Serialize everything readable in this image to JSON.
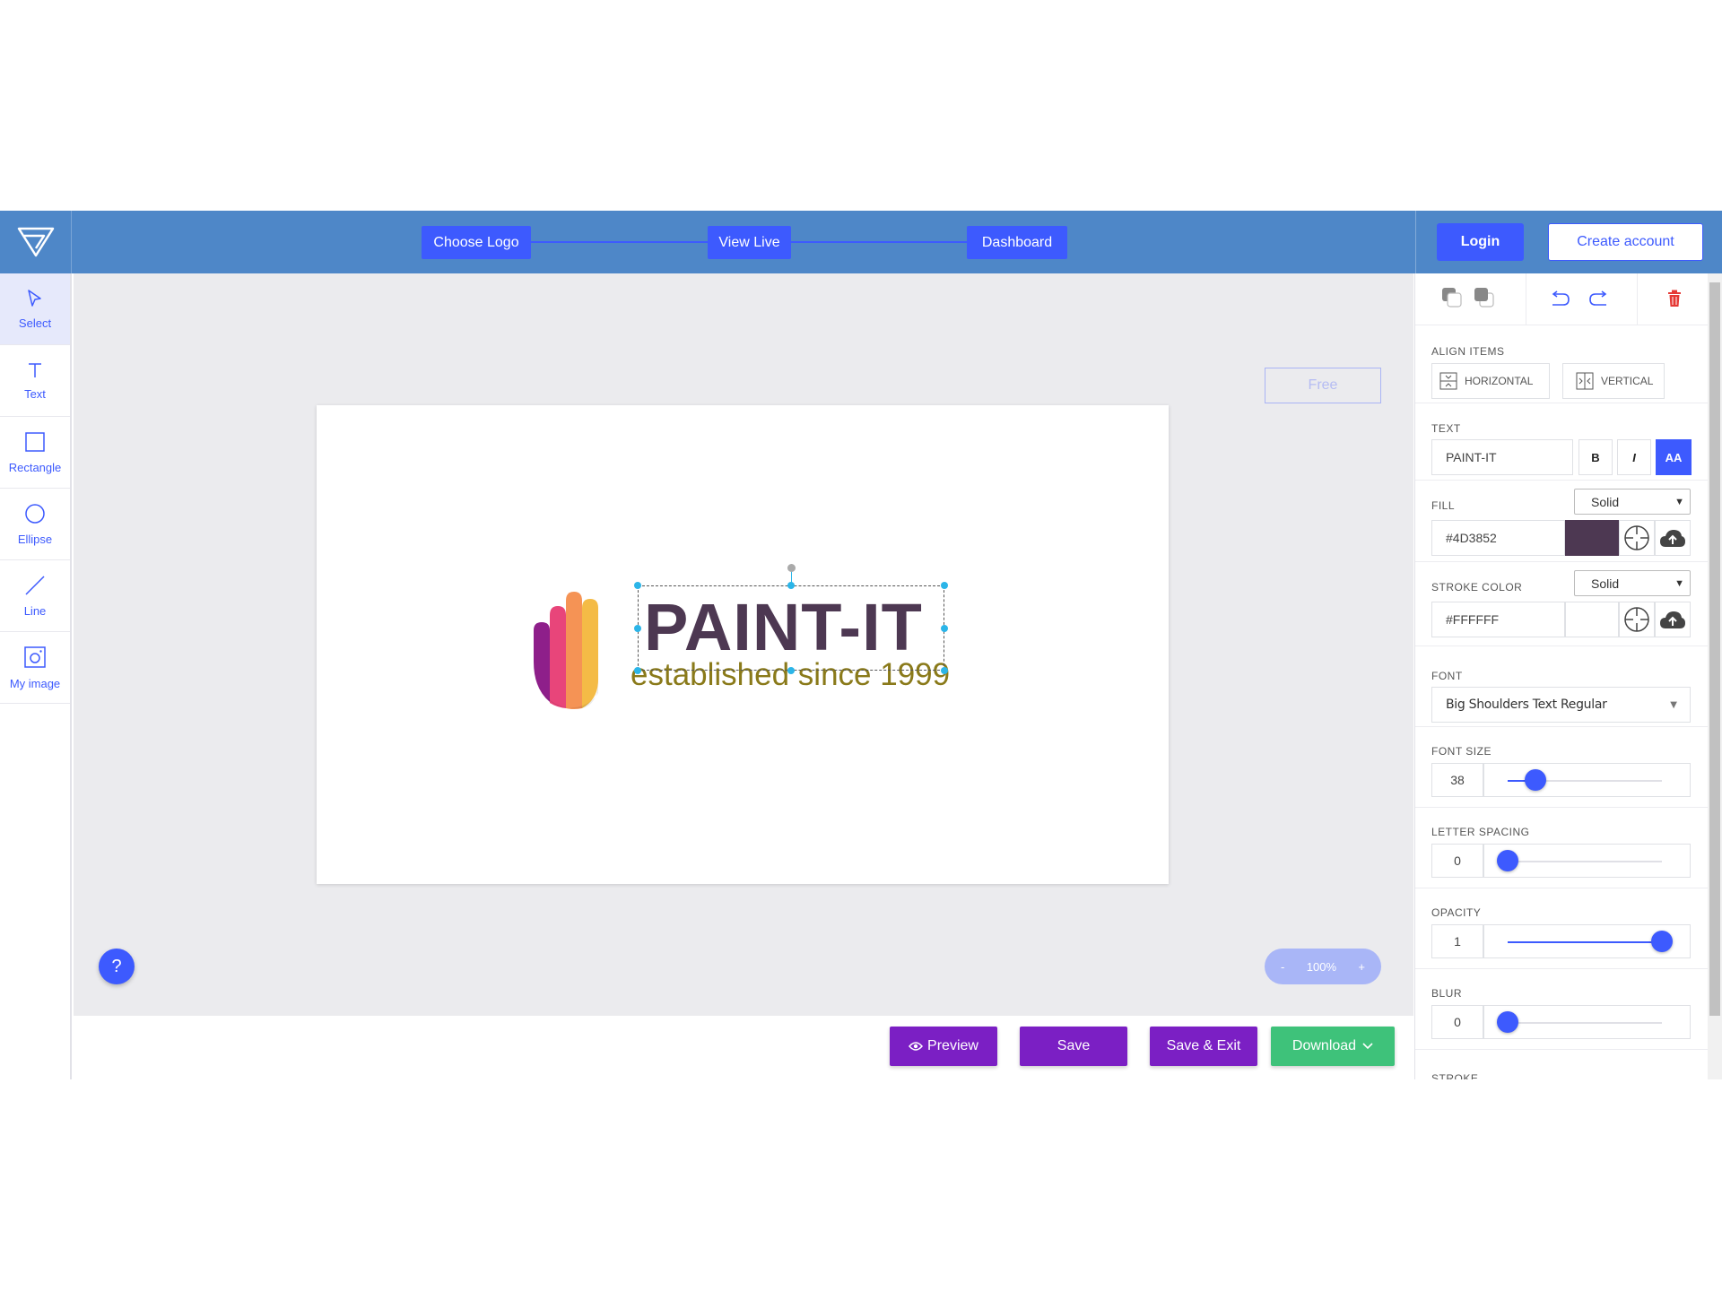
{
  "topbar": {
    "steps": [
      "Choose Logo",
      "View Live",
      "Dashboard"
    ],
    "login_label": "Login",
    "create_account_label": "Create account",
    "color": "#4e87c8",
    "accent": "#3d5afe"
  },
  "tools": [
    {
      "label": "Select",
      "icon": "cursor-icon"
    },
    {
      "label": "Text",
      "icon": "text-icon"
    },
    {
      "label": "Rectangle",
      "icon": "rectangle-icon"
    },
    {
      "label": "Ellipse",
      "icon": "ellipse-icon"
    },
    {
      "label": "Line",
      "icon": "line-icon"
    },
    {
      "label": "My image",
      "icon": "image-icon"
    }
  ],
  "canvas": {
    "free_label": "Free",
    "brand_text": "PAINT-IT",
    "tagline": "established since 1999",
    "help_label": "?",
    "zoom": {
      "minus": "-",
      "value": "100%",
      "plus": "+"
    }
  },
  "actions": {
    "preview_label": "Preview",
    "save_label": "Save",
    "save_exit_label": "Save & Exit",
    "download_label": "Download",
    "colors": {
      "purple": "#7b1fc4",
      "green": "#3ec27a"
    }
  },
  "panel": {
    "align_items": {
      "label": "ALIGN ITEMS",
      "horizontal": "HORIZONTAL",
      "vertical": "VERTICAL"
    },
    "text": {
      "label": "TEXT",
      "value": "PAINT-IT",
      "bold": "B",
      "italic": "I",
      "caps": "AA"
    },
    "fill": {
      "label": "FILL",
      "mode": "Solid",
      "value": "#4D3852",
      "swatch": "#4d3852"
    },
    "stroke_color": {
      "label": "STROKE COLOR",
      "mode": "Solid",
      "value": "#FFFFFF",
      "swatch": "#ffffff"
    },
    "font": {
      "label": "FONT",
      "value": "Big Shoulders Text Regular"
    },
    "font_size": {
      "label": "FONT SIZE",
      "value": "38",
      "level": 0.18
    },
    "letter_spacing": {
      "label": "LETTER SPACING",
      "value": "0",
      "level": 0.0
    },
    "opacity": {
      "label": "OPACITY",
      "value": "1",
      "level": 1.0
    },
    "blur": {
      "label": "BLUR",
      "value": "0",
      "level": 0.0
    },
    "stroke": {
      "label": "STROKE"
    }
  }
}
